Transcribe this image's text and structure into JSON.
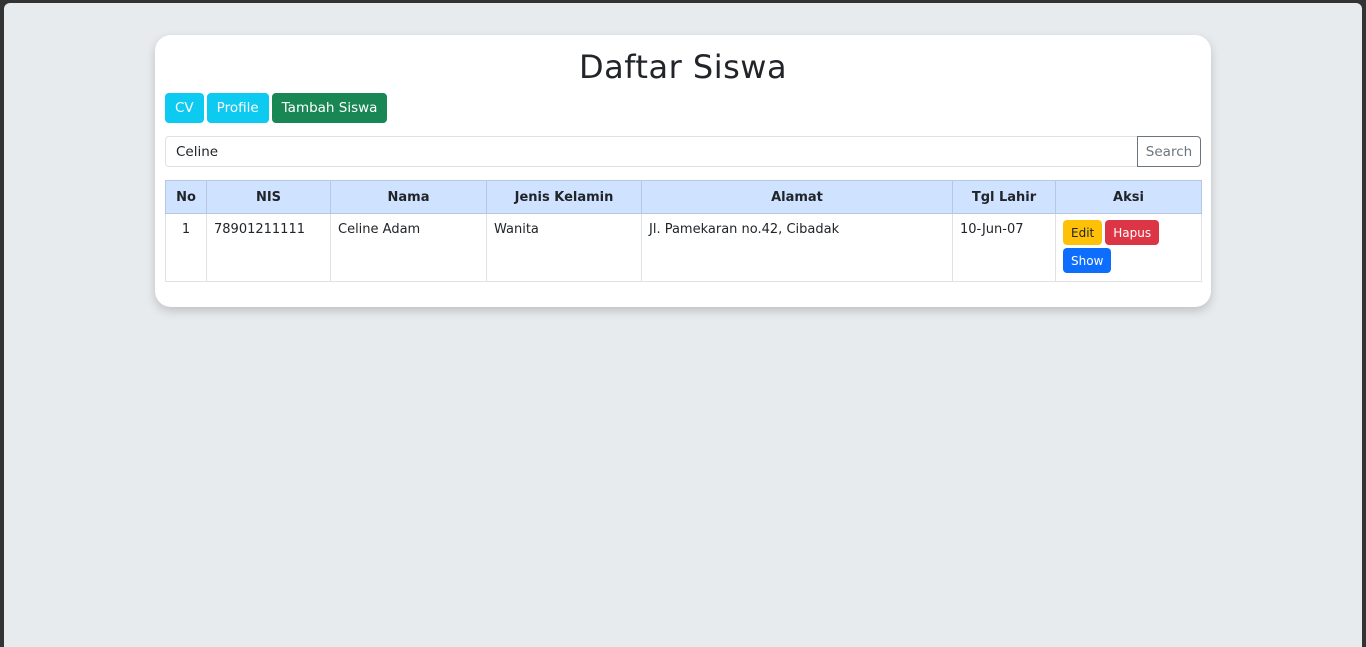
{
  "page": {
    "title": "Daftar Siswa"
  },
  "nav_buttons": {
    "cv": "CV",
    "profile": "Profile",
    "tambah": "Tambah Siswa"
  },
  "search": {
    "value": "Celine",
    "button": "Search"
  },
  "table": {
    "headers": [
      "No",
      "NIS",
      "Nama",
      "Jenis Kelamin",
      "Alamat",
      "Tgl Lahir",
      "Aksi"
    ],
    "rows": [
      {
        "no": "1",
        "nis": "78901211111",
        "nama": "Celine Adam",
        "jenis_kelamin": "Wanita",
        "alamat": "Jl. Pamekaran no.42, Cibadak",
        "tgl_lahir": "10-Jun-07",
        "actions": {
          "edit": "Edit",
          "hapus": "Hapus",
          "show": "Show"
        }
      }
    ]
  },
  "colors": {
    "info": "#0dcaf0",
    "success": "#198754",
    "warning": "#ffc107",
    "danger": "#dc3545",
    "primary": "#0d6efd",
    "table_header": "#cfe2ff",
    "background": "#e8ebee"
  }
}
